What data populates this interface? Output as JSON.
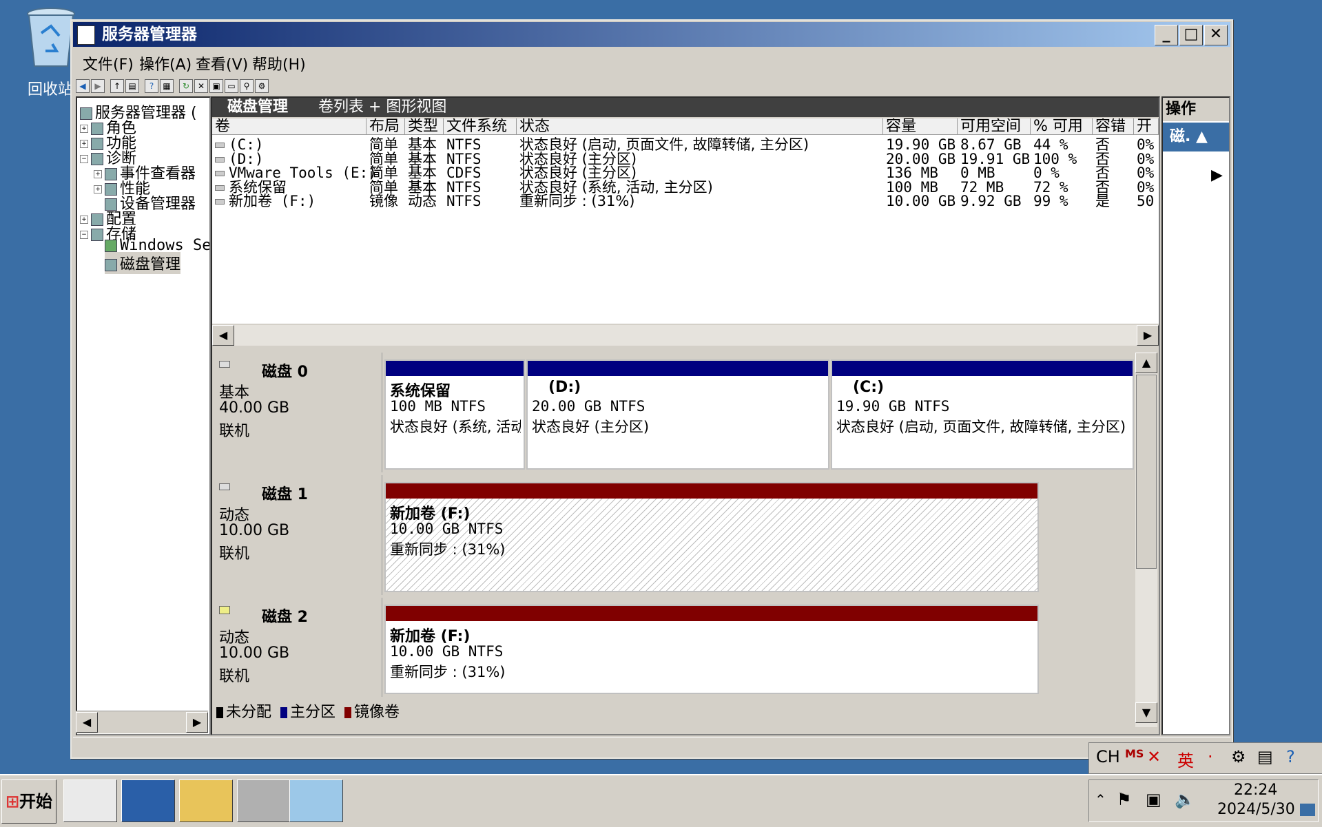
{
  "desktop": {
    "recycle_label": "回收站"
  },
  "window": {
    "title": "服务器管理器",
    "menu": [
      "文件(F)",
      "操作(A)",
      "查看(V)",
      "帮助(H)"
    ]
  },
  "tree": {
    "root": "服务器管理器 (",
    "items": [
      "角色",
      "功能",
      "诊断",
      "事件查看器",
      "性能",
      "设备管理器",
      "配置",
      "存储",
      "Windows Ser",
      "磁盘管理"
    ]
  },
  "center": {
    "title": "磁盘管理",
    "subtitle": "卷列表 + 图形视图",
    "columns": [
      "卷",
      "布局",
      "类型",
      "文件系统",
      "状态",
      "容量",
      "可用空间",
      "% 可用",
      "容错",
      "开"
    ],
    "rows": [
      [
        "(C:)",
        "简单",
        "基本",
        "NTFS",
        "状态良好 (启动, 页面文件, 故障转储, 主分区)",
        "19.90 GB",
        "8.67 GB",
        "44 %",
        "否",
        "0%"
      ],
      [
        "(D:)",
        "简单",
        "基本",
        "NTFS",
        "状态良好 (主分区)",
        "20.00 GB",
        "19.91 GB",
        "100 %",
        "否",
        "0%"
      ],
      [
        "VMware Tools (E:)",
        "简单",
        "基本",
        "CDFS",
        "状态良好 (主分区)",
        "136 MB",
        "0 MB",
        "0 %",
        "否",
        "0%"
      ],
      [
        "系统保留",
        "简单",
        "基本",
        "NTFS",
        "状态良好 (系统, 活动, 主分区)",
        "100 MB",
        "72 MB",
        "72 %",
        "否",
        "0%"
      ],
      [
        "新加卷 (F:)",
        "镜像",
        "动态",
        "NTFS",
        "重新同步 : (31%)",
        "10.00 GB",
        "9.92 GB",
        "99 %",
        "是",
        "50"
      ]
    ]
  },
  "disks": [
    {
      "name": "磁盘 0",
      "type": "基本",
      "size": "40.00 GB",
      "status": "联机",
      "partitions": [
        {
          "title": "系统保留",
          "line1": "100 MB NTFS",
          "line2": "状态良好 (系统, 活动, 主分区)"
        },
        {
          "title": "(D:)",
          "line1": "20.00 GB NTFS",
          "line2": "状态良好 (主分区)"
        },
        {
          "title": "(C:)",
          "line1": "19.90 GB NTFS",
          "line2": "状态良好 (启动, 页面文件, 故障转储, 主分区)"
        }
      ]
    },
    {
      "name": "磁盘 1",
      "type": "动态",
      "size": "10.00 GB",
      "status": "联机",
      "partitions": [
        {
          "title": "新加卷 (F:)",
          "line1": "10.00 GB NTFS",
          "line2": "重新同步 : (31%)"
        }
      ]
    },
    {
      "name": "磁盘 2",
      "type": "动态",
      "size": "10.00 GB",
      "status": "联机",
      "partitions": [
        {
          "title": "新加卷 (F:)",
          "line1": "10.00 GB NTFS",
          "line2": "重新同步 : (31%)"
        }
      ]
    }
  ],
  "legend": [
    "未分配",
    "主分区",
    "镜像卷"
  ],
  "actions": {
    "header": "操作",
    "item": "磁."
  },
  "langbar": {
    "ch": "CH",
    "ying": "英"
  },
  "taskbar": {
    "start": "开始",
    "time": "22:24",
    "date": "2024/5/30"
  },
  "colors": {
    "primary_partition": "#000080",
    "mirror_volume": "#800000",
    "title_gradient_start": "#0a246a",
    "desktop": "#3a6ea5"
  }
}
